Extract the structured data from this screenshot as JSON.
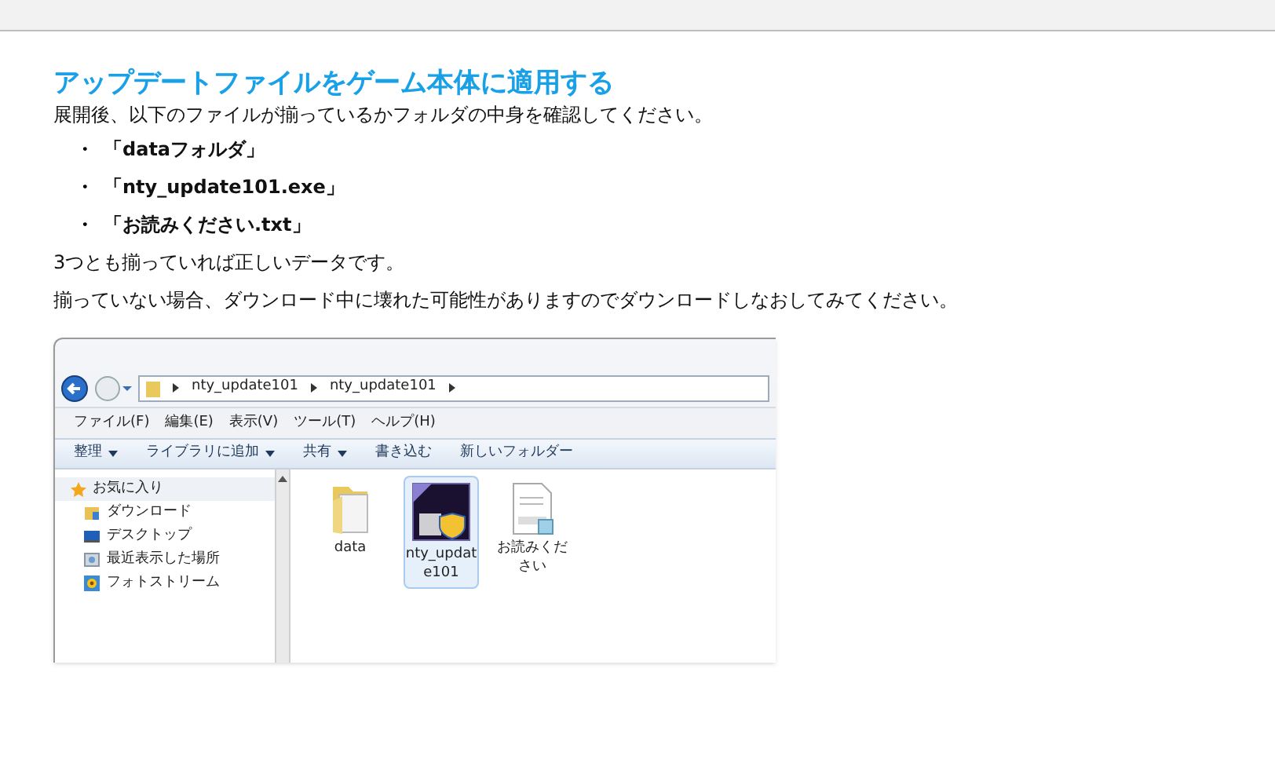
{
  "heading": "アップデートファイルをゲーム本体に適用する",
  "intro": "展開後、以下のファイルが揃っているかフォルダの中身を確認してください。",
  "bullets": [
    {
      "marker": "・",
      "text": "「dataフォルダ」"
    },
    {
      "marker": "・",
      "text": "「nty_update101.exe」"
    },
    {
      "marker": "・",
      "text": "「お読みください.txt」"
    }
  ],
  "notes": [
    "3つとも揃っていれば正しいデータです。",
    "揃っていない場合、ダウンロード中に壊れた可能性がありますのでダウンロードしなおしてみてください。"
  ],
  "screenshot": {
    "address_path": [
      "nty_update101",
      "nty_update101"
    ],
    "menu": [
      "ファイル(F)",
      "編集(E)",
      "表示(V)",
      "ツール(T)",
      "ヘルプ(H)"
    ],
    "toolbar": [
      {
        "label": "整理",
        "dropdown": true
      },
      {
        "label": "ライブラリに追加",
        "dropdown": true
      },
      {
        "label": "共有",
        "dropdown": true
      },
      {
        "label": "書き込む",
        "dropdown": false
      },
      {
        "label": "新しいフォルダー",
        "dropdown": false
      }
    ],
    "sidebar": {
      "header": "お気に入り",
      "items": [
        {
          "label": "ダウンロード",
          "kind": "download"
        },
        {
          "label": "デスクトップ",
          "kind": "desktop"
        },
        {
          "label": "最近表示した場所",
          "kind": "recent"
        },
        {
          "label": "フォトストリーム",
          "kind": "photo"
        }
      ]
    },
    "files": [
      {
        "name": "data",
        "kind": "folder",
        "selected": false
      },
      {
        "name": "nty_update101",
        "kind": "exe",
        "selected": true
      },
      {
        "name": "お読みください",
        "kind": "text",
        "selected": false
      }
    ]
  }
}
